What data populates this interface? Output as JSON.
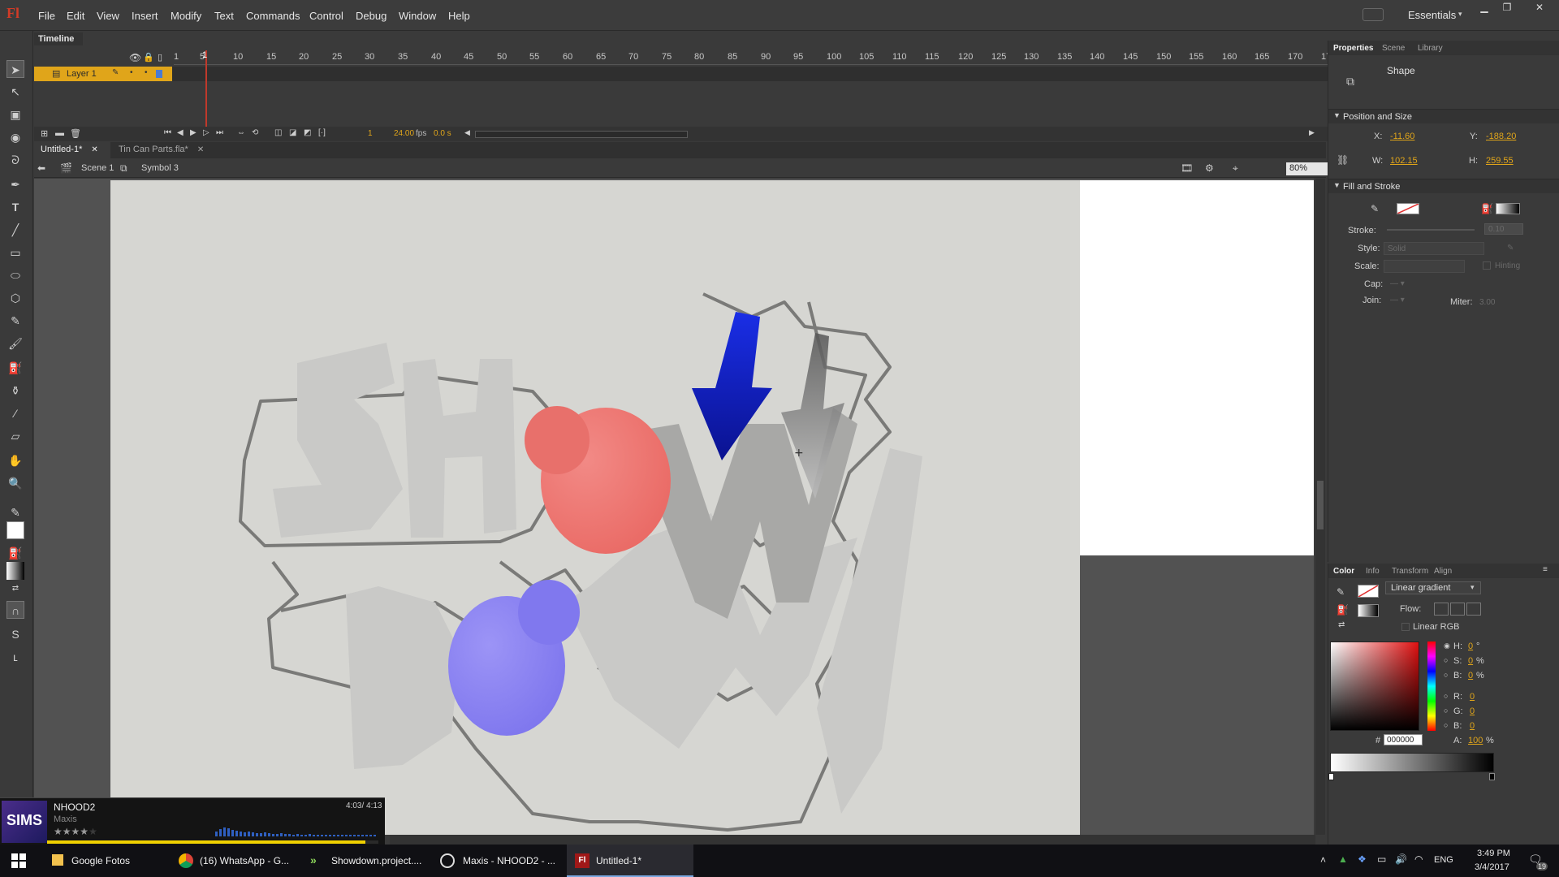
{
  "app": {
    "logo_text": "Fl"
  },
  "menu": {
    "items": [
      "File",
      "Edit",
      "View",
      "Insert",
      "Modify",
      "Text",
      "Commands",
      "Control",
      "Debug",
      "Window",
      "Help"
    ],
    "workspace": "Essentials"
  },
  "timeline": {
    "tab_label": "Timeline",
    "frame_ticks": [
      "1",
      "5",
      "10",
      "15",
      "20",
      "25",
      "30",
      "35",
      "40",
      "45",
      "50",
      "55",
      "60",
      "65",
      "70",
      "75",
      "80",
      "85",
      "90",
      "95",
      "100",
      "105",
      "110",
      "115",
      "120",
      "125",
      "130",
      "135",
      "140",
      "145",
      "150",
      "155",
      "160",
      "165",
      "170",
      "17"
    ],
    "layer_name": "Layer 1",
    "current_frame": "1",
    "fps": "24.00",
    "fps_unit": "fps",
    "time": "0.0 s"
  },
  "documents": {
    "tabs": [
      {
        "label": "Untitled-1*",
        "active": true
      },
      {
        "label": "Tin Can Parts.fla*",
        "active": false
      }
    ]
  },
  "breadcrumb": {
    "scene": "Scene 1",
    "symbol": "Symbol 3",
    "zoom": "80%"
  },
  "properties": {
    "tabs": [
      "Properties",
      "Scene",
      "Library"
    ],
    "object_type": "Shape",
    "position_size_title": "Position and Size",
    "x_label": "X:",
    "x_value": "-11.60",
    "y_label": "Y:",
    "y_value": "-188.20",
    "w_label": "W:",
    "w_value": "102.15",
    "h_label": "H:",
    "h_value": "259.55",
    "fill_stroke_title": "Fill and Stroke",
    "stroke_label": "Stroke:",
    "stroke_value": "0.10",
    "style_label": "Style:",
    "style_value": "Solid",
    "scale_label": "Scale:",
    "hinting_label": "Hinting",
    "cap_label": "Cap:",
    "join_label": "Join:",
    "miter_label": "Miter:",
    "miter_value": "3.00"
  },
  "color_panel": {
    "tabs": [
      "Color",
      "Info",
      "Transform",
      "Align"
    ],
    "fill_type": "Linear gradient",
    "flow_label": "Flow:",
    "linear_rgb_label": "Linear RGB",
    "h_label": "H:",
    "h_value": "0",
    "h_unit": "°",
    "s_label": "S:",
    "s_value": "0",
    "s_unit": "%",
    "b_label": "B:",
    "b_value": "0",
    "b_unit": "%",
    "r_label": "R:",
    "r_value": "0",
    "g_label": "G:",
    "g_value": "0",
    "bb_label": "B:",
    "bb_value": "0",
    "hex_label": "#",
    "hex_value": "000000",
    "alpha_label": "A:",
    "alpha_value": "100",
    "alpha_unit": "%"
  },
  "music_player": {
    "logo": "SIMS",
    "track": "NHOOD2",
    "artist": "Maxis",
    "time": "4:03/ 4:13",
    "rating_stars": 4,
    "progress": 0.96
  },
  "taskbar": {
    "items": [
      {
        "label": "Google Fotos",
        "icon": "folder-icon",
        "active": false
      },
      {
        "label": "(16) WhatsApp - G...",
        "icon": "chrome-icon",
        "active": false
      },
      {
        "label": "Showdown.project....",
        "icon": "project-icon",
        "active": false
      },
      {
        "label": "Maxis - NHOOD2 - ...",
        "icon": "media-player-icon",
        "active": false
      },
      {
        "label": "Untitled-1*",
        "icon": "flash-icon",
        "active": true
      }
    ],
    "language": "ENG",
    "time": "3:49 PM",
    "date": "3/4/2017",
    "notifications": "19"
  },
  "colors": {
    "accent_orange": "#e0a51a",
    "playhead_red": "#c0392b",
    "shape_red": "#ef7b78",
    "shape_blue": "#8e86f4",
    "arrow_blue": "#1020d8"
  }
}
